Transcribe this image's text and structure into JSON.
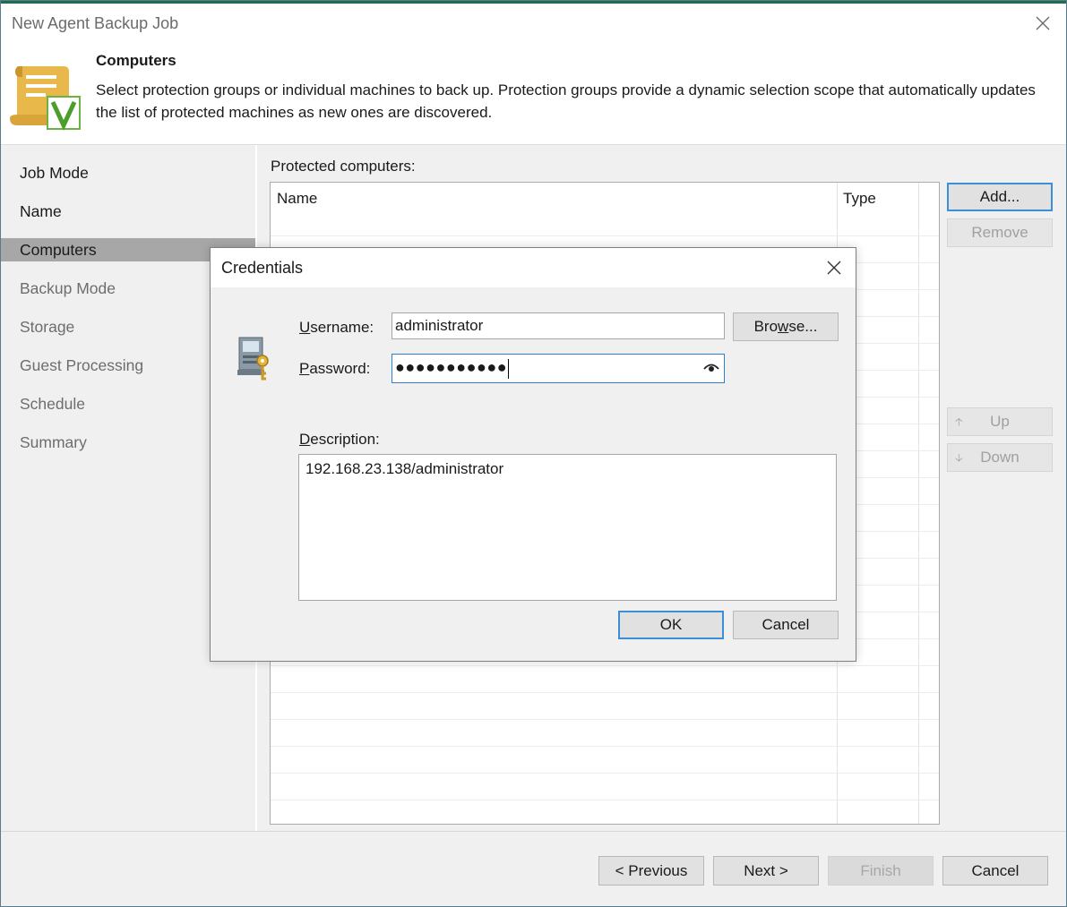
{
  "window": {
    "title": "New Agent Backup Job"
  },
  "header": {
    "title": "Computers",
    "description": "Select protection groups or individual machines to back up. Protection groups provide a dynamic selection scope that automatically updates the list of protected machines as new ones are discovered."
  },
  "nav": {
    "items": [
      {
        "label": "Job Mode",
        "state": "done"
      },
      {
        "label": "Name",
        "state": "done"
      },
      {
        "label": "Computers",
        "state": "active"
      },
      {
        "label": "Backup Mode",
        "state": "pending"
      },
      {
        "label": "Storage",
        "state": "pending"
      },
      {
        "label": "Guest Processing",
        "state": "pending"
      },
      {
        "label": "Schedule",
        "state": "pending"
      },
      {
        "label": "Summary",
        "state": "pending"
      }
    ]
  },
  "content": {
    "label": "Protected computers:",
    "columns": {
      "name": "Name",
      "type": "Type"
    }
  },
  "side_buttons": {
    "add": "Add...",
    "remove": "Remove",
    "up": "Up",
    "down": "Down"
  },
  "footer": {
    "previous": "< Previous",
    "next": "Next >",
    "finish": "Finish",
    "cancel": "Cancel"
  },
  "dialog": {
    "title": "Credentials",
    "username_label_rest": "sername:",
    "username_label_acc": "U",
    "username_value": "administrator",
    "browse_label_pre": "Bro",
    "browse_label_acc": "w",
    "browse_label_post": "se...",
    "password_label_acc": "P",
    "password_label_rest": "assword:",
    "password_value": "●●●●●●●●●●●",
    "description_label_acc": "D",
    "description_label_rest": "escription:",
    "description_value": "192.168.23.138/administrator",
    "ok": "OK",
    "cancel": "Cancel"
  },
  "colors": {
    "accent": "#1f6d4e",
    "focus": "#3c8fd6",
    "nav_active": "#a7a7a7"
  }
}
